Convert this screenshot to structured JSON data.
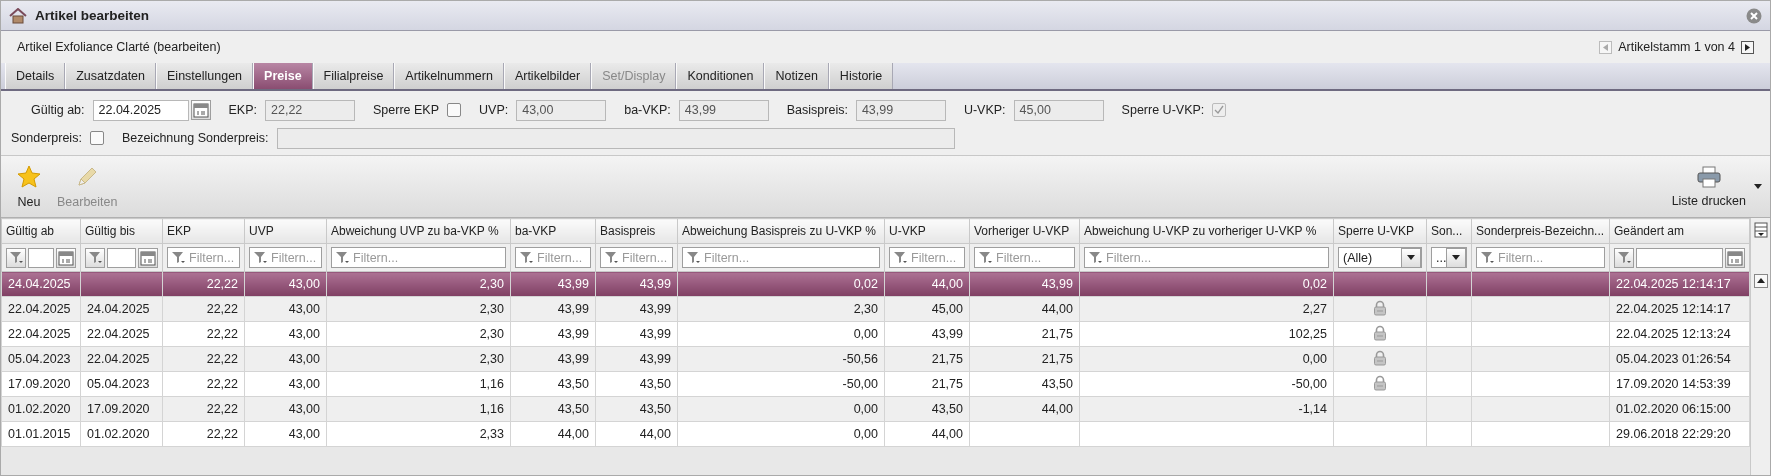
{
  "window": {
    "title": "Artikel bearbeiten"
  },
  "header": {
    "subtitle": "Artikel Exfoliance Clarté (bearbeiten)",
    "pager": {
      "label": "Artikelstamm 1 von 4",
      "prev_disabled": true,
      "next_disabled": false
    }
  },
  "tabs": [
    {
      "label": "Details",
      "selected": false,
      "disabled": false
    },
    {
      "label": "Zusatzdaten",
      "selected": false,
      "disabled": false
    },
    {
      "label": "Einstellungen",
      "selected": false,
      "disabled": false
    },
    {
      "label": "Preise",
      "selected": true,
      "disabled": false
    },
    {
      "label": "Filialpreise",
      "selected": false,
      "disabled": false
    },
    {
      "label": "Artikelnummern",
      "selected": false,
      "disabled": false
    },
    {
      "label": "Artikelbilder",
      "selected": false,
      "disabled": false
    },
    {
      "label": "Set/Display",
      "selected": false,
      "disabled": true
    },
    {
      "label": "Konditionen",
      "selected": false,
      "disabled": false
    },
    {
      "label": "Notizen",
      "selected": false,
      "disabled": false
    },
    {
      "label": "Historie",
      "selected": false,
      "disabled": false
    }
  ],
  "form": {
    "rows": [
      [
        {
          "kind": "date",
          "label": "Gültig ab:",
          "value": "22.04.2025",
          "readonly": false
        },
        {
          "kind": "text",
          "label": "EKP:",
          "value": "22,22",
          "readonly": true
        },
        {
          "kind": "checkbox",
          "label": "Sperre EKP",
          "checked": false,
          "disabled": false
        },
        {
          "kind": "text",
          "label": "UVP:",
          "value": "43,00",
          "readonly": true
        },
        {
          "kind": "text",
          "label": "ba-VKP:",
          "value": "43,99",
          "readonly": true
        },
        {
          "kind": "text",
          "label": "Basispreis:",
          "value": "43,99",
          "readonly": true
        },
        {
          "kind": "text",
          "label": "U-VKP:",
          "value": "45,00",
          "readonly": true
        },
        {
          "kind": "checkbox",
          "label": "Sperre U-VKP:",
          "checked": true,
          "disabled": true
        }
      ],
      [
        {
          "kind": "checkbox",
          "label": "Sonderpreis:",
          "checked": false,
          "disabled": false
        },
        {
          "kind": "longtext",
          "label": "Bezeichnung Sonderpreis:",
          "readonly": true
        }
      ]
    ]
  },
  "toolbar": {
    "left": [
      {
        "kind": "new",
        "label": "Neu",
        "disabled": false
      },
      {
        "kind": "edit",
        "label": "Bearbeiten",
        "disabled": true
      }
    ],
    "right": {
      "label": "Liste drucken"
    }
  },
  "table": {
    "columns": [
      {
        "label": "Gültig ab",
        "kind": "date",
        "filter": {
          "kind": "date"
        }
      },
      {
        "label": "Gültig bis",
        "kind": "date",
        "filter": {
          "kind": "date"
        }
      },
      {
        "label": "EKP",
        "kind": "number",
        "filter": {
          "kind": "text",
          "placeholder": "Filtern..."
        }
      },
      {
        "label": "UVP",
        "kind": "number",
        "filter": {
          "kind": "text",
          "placeholder": "Filtern..."
        }
      },
      {
        "label": "Abweichung UVP zu ba-VKP %",
        "kind": "number",
        "filter": {
          "kind": "text",
          "placeholder": "Filtern..."
        }
      },
      {
        "label": "ba-VKP",
        "kind": "number",
        "filter": {
          "kind": "text",
          "placeholder": "Filtern..."
        }
      },
      {
        "label": "Basispreis",
        "kind": "number",
        "filter": {
          "kind": "text",
          "placeholder": "Filtern..."
        }
      },
      {
        "label": "Abweichung Basispreis zu U-VKP %",
        "kind": "number",
        "filter": {
          "kind": "text",
          "placeholder": "Filtern..."
        }
      },
      {
        "label": "U-VKP",
        "kind": "number",
        "filter": {
          "kind": "text",
          "placeholder": "Filtern..."
        }
      },
      {
        "label": "Vorheriger U-VKP",
        "kind": "number",
        "filter": {
          "kind": "text",
          "placeholder": "Filtern..."
        }
      },
      {
        "label": "Abweichung U-VKP zu vorheriger U-VKP %",
        "kind": "number",
        "filter": {
          "kind": "text",
          "placeholder": "Filtern..."
        }
      },
      {
        "label": "Sperre U-VKP",
        "kind": "lock",
        "filter": {
          "kind": "select",
          "value": "(Alle)"
        }
      },
      {
        "label": "Son...",
        "kind": "text",
        "filter": {
          "kind": "select",
          "value": "..."
        }
      },
      {
        "label": "Sonderpreis-Bezeichn...",
        "kind": "text",
        "filter": {
          "kind": "text",
          "placeholder": "Filtern..."
        }
      },
      {
        "label": "Geändert am",
        "kind": "date",
        "filter": {
          "kind": "date"
        }
      }
    ],
    "rows": [
      {
        "selected": true,
        "locked": false,
        "cells": [
          "24.04.2025",
          null,
          "22,22",
          "43,00",
          "2,30",
          "43,99",
          "43,99",
          "0,02",
          "44,00",
          "43,99",
          "0,02",
          null,
          null,
          null,
          "22.04.2025 12:14:17"
        ]
      },
      {
        "selected": false,
        "locked": true,
        "cells": [
          "22.04.2025",
          "24.04.2025",
          "22,22",
          "43,00",
          "2,30",
          "43,99",
          "43,99",
          "2,30",
          "45,00",
          "44,00",
          "2,27",
          null,
          null,
          null,
          "22.04.2025 12:14:17"
        ]
      },
      {
        "selected": false,
        "locked": true,
        "cells": [
          "22.04.2025",
          "22.04.2025",
          "22,22",
          "43,00",
          "2,30",
          "43,99",
          "43,99",
          "0,00",
          "43,99",
          "21,75",
          "102,25",
          null,
          null,
          null,
          "22.04.2025 12:13:24"
        ]
      },
      {
        "selected": false,
        "locked": true,
        "cells": [
          "05.04.2023",
          "22.04.2025",
          "22,22",
          "43,00",
          "2,30",
          "43,99",
          "43,99",
          "-50,56",
          "21,75",
          "21,75",
          "0,00",
          null,
          null,
          null,
          "05.04.2023 01:26:54"
        ]
      },
      {
        "selected": false,
        "locked": true,
        "cells": [
          "17.09.2020",
          "05.04.2023",
          "22,22",
          "43,00",
          "1,16",
          "43,50",
          "43,50",
          "-50,00",
          "21,75",
          "43,50",
          "-50,00",
          null,
          null,
          null,
          "17.09.2020 14:53:39"
        ]
      },
      {
        "selected": false,
        "locked": false,
        "cells": [
          "01.02.2020",
          "17.09.2020",
          "22,22",
          "43,00",
          "1,16",
          "43,50",
          "43,50",
          "0,00",
          "43,50",
          "44,00",
          "-1,14",
          null,
          null,
          null,
          "01.02.2020 06:15:00"
        ]
      },
      {
        "selected": false,
        "locked": false,
        "cells": [
          "01.01.2015",
          "01.02.2020",
          "22,22",
          "43,00",
          "2,33",
          "44,00",
          "44,00",
          "0,00",
          "44,00",
          null,
          null,
          null,
          null,
          null,
          "29.06.2018 22:29:20"
        ]
      }
    ]
  }
}
